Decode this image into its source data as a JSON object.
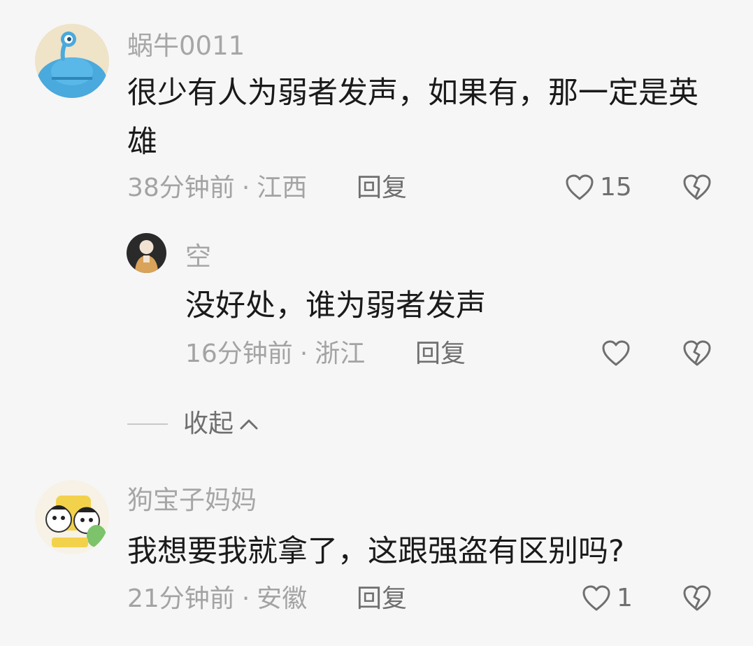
{
  "comments": [
    {
      "username": "蜗牛0011",
      "text": "很少有人为弱者发声，如果有，那一定是英雄",
      "time": "38分钟前",
      "location": "江西",
      "reply_label": "回复",
      "likes": "15",
      "avatar_icon": "blue-snail-avatar",
      "replies": [
        {
          "username": "空",
          "text": "没好处，谁为弱者发声",
          "time": "16分钟前",
          "location": "浙江",
          "reply_label": "回复",
          "likes": "",
          "avatar_icon": "person-avatar"
        }
      ]
    },
    {
      "username": "狗宝子妈妈",
      "text": "我想要我就拿了，这跟强盗有区别吗?",
      "time": "21分钟前",
      "location": "安徽",
      "reply_label": "回复",
      "likes": "1",
      "avatar_icon": "cartoon-avatar"
    }
  ],
  "collapse_label": "收起",
  "separator": "·",
  "colors": {
    "background": "#f6f6f6",
    "text_primary": "#1a1a1a",
    "text_secondary": "#a3a3a3",
    "icon": "#6f6f6f"
  }
}
